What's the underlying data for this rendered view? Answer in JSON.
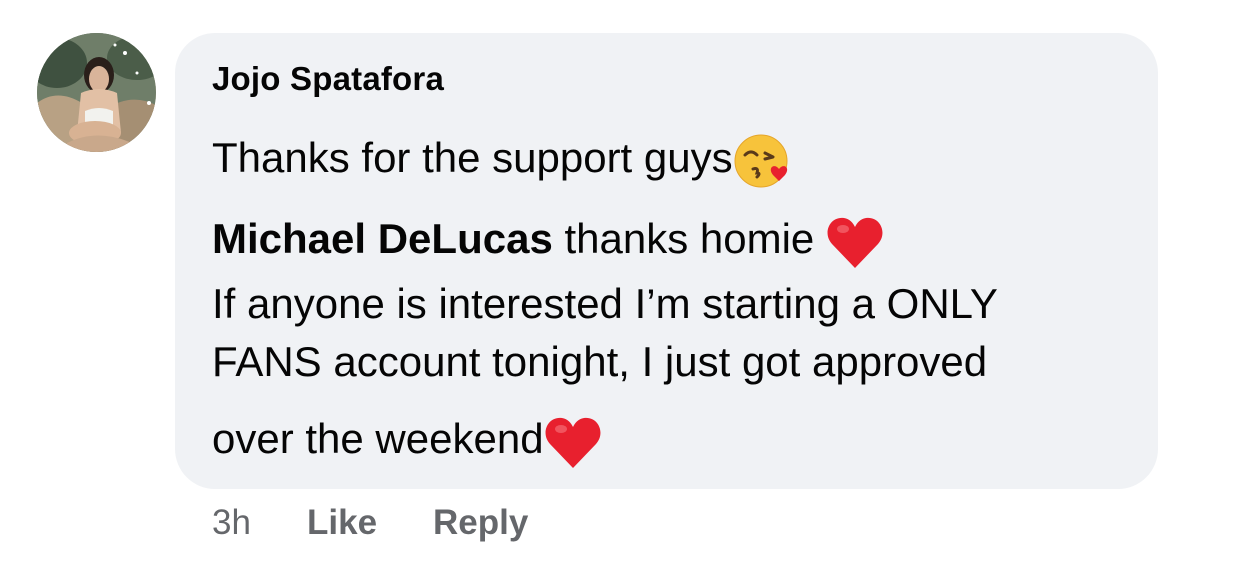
{
  "comment": {
    "author": "Jojo Spatafora",
    "text_line1": "Thanks for the support guys",
    "text_line1_emoji": "kissing-heart-emoji",
    "mention_name": "Michael DeLucas",
    "mention_text": " thanks homie ",
    "mention_emoji": "red-heart-emoji",
    "text_line3": "If anyone is interested I’m starting a ONLY",
    "text_line4": "FANS account tonight, I just got approved",
    "text_line5": "over the weekend",
    "text_line5_emoji": "red-heart-emoji"
  },
  "actions": {
    "time": "3h",
    "like_label": "Like",
    "reply_label": "Reply"
  },
  "colors": {
    "bubble_bg": "#f0f2f5",
    "action_text": "#65676b",
    "heart": "#e8202e"
  }
}
